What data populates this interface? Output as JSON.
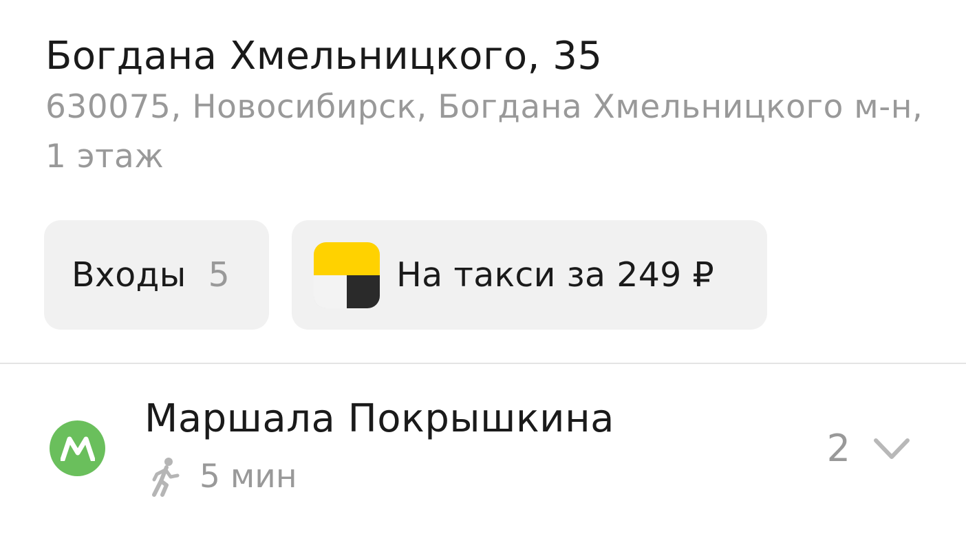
{
  "address": {
    "title": "Богдана Хмельницкого, 35",
    "details": "630075, Новосибирск, Богдана Хмельницкого м-н, 1 этаж"
  },
  "actions": {
    "entrances_label": "Входы",
    "entrances_count": "5",
    "taxi_label": "На такси за 249 ₽"
  },
  "metro": {
    "icon_letter": "M",
    "station": "Маршала Покрышкина",
    "walk_time": "5 мин",
    "count": "2",
    "color": "#6abf5c"
  },
  "colors": {
    "taxi_yellow": "#ffd200",
    "chip_bg": "#f1f1f1",
    "secondary_text": "#999999"
  }
}
